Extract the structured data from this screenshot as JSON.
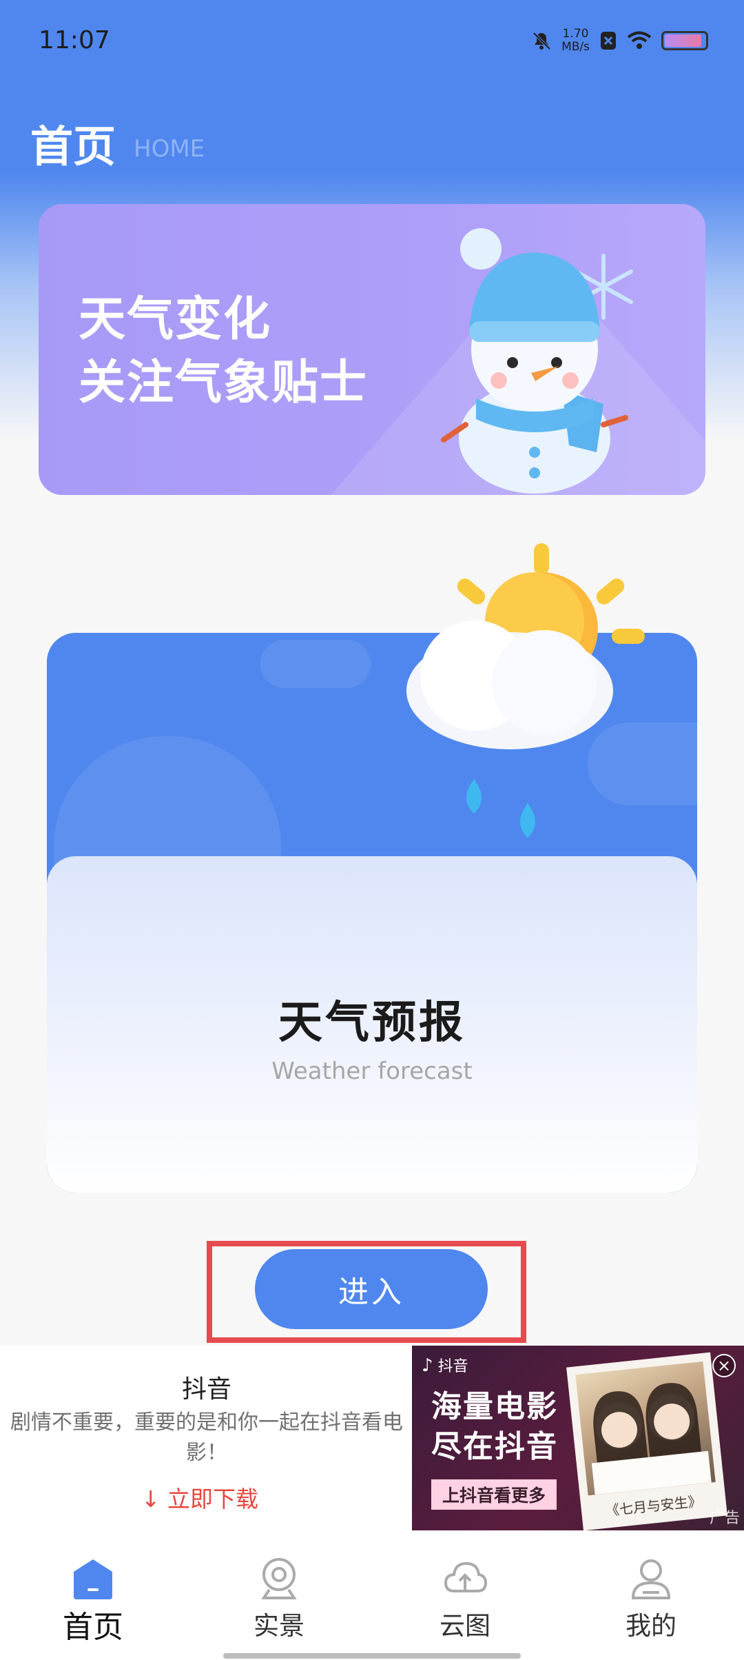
{
  "status_bar": {
    "time": "11:07",
    "net_speed_value": "1.70",
    "net_speed_unit": "MB/s"
  },
  "header": {
    "title": "首页",
    "subtitle": "HOME"
  },
  "banner": {
    "line1": "天气变化",
    "line2": "关注气象贴士"
  },
  "forecast": {
    "title": "天气预报",
    "subtitle": "Weather forecast",
    "enter_label": "进入"
  },
  "ad": {
    "app_name": "抖音",
    "description": "剧情不重要，重要的是和你一起在抖音看电影！",
    "download_label": "↓ 立即下载",
    "brand": "抖音",
    "slogan_line1": "海量电影",
    "slogan_line2": "尽在抖音",
    "tag": "上抖音看更多",
    "photo_caption": "《七月与安生》",
    "ad_label": "广告"
  },
  "bottom_nav": {
    "items": [
      {
        "label": "首页",
        "icon": "home-icon",
        "active": true
      },
      {
        "label": "实景",
        "icon": "location-camera-icon",
        "active": false
      },
      {
        "label": "云图",
        "icon": "cloud-upload-icon",
        "active": false
      },
      {
        "label": "我的",
        "icon": "user-icon",
        "active": false
      }
    ]
  },
  "colors": {
    "primary": "#4f87ee",
    "banner": "#ab9cf7",
    "highlight": "#e64b50",
    "download": "#e8473d"
  }
}
